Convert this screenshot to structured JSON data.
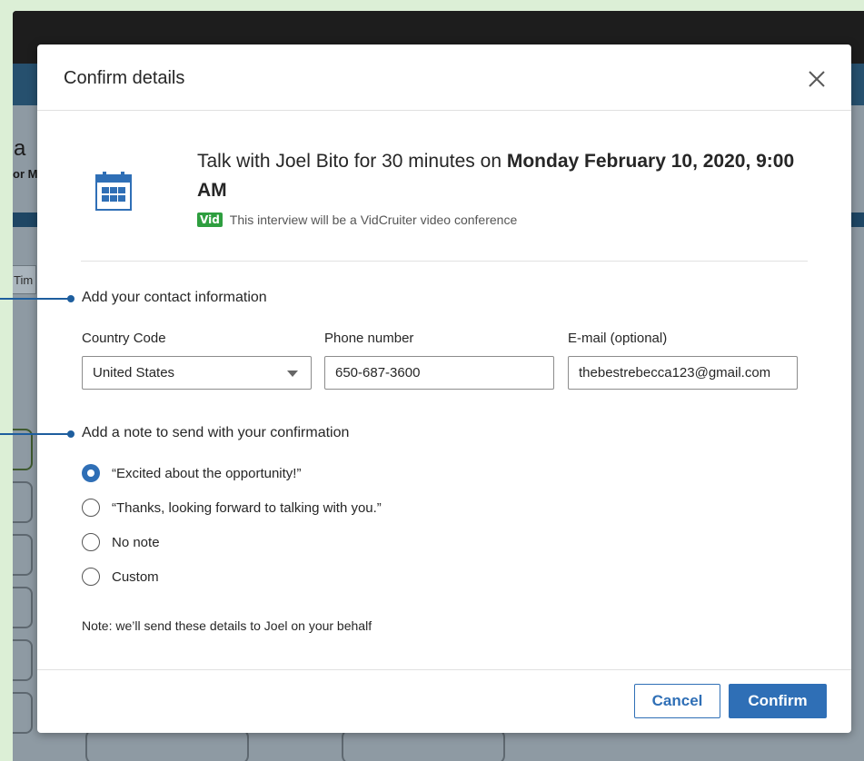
{
  "background": {
    "peek_a": "a",
    "peek_or": "or M",
    "peek_tim": "Tim"
  },
  "modal": {
    "title": "Confirm details",
    "summary": {
      "prefix": "Talk with Joel Bito for 30 minutes on ",
      "datetime": "Monday February 10, 2020, 9:00 AM",
      "vid_badge": "Vid",
      "vid_text": "This interview will be a VidCruiter video conference"
    },
    "contact": {
      "title": "Add your contact information",
      "country_label": "Country Code",
      "country_value": "United States",
      "phone_label": "Phone number",
      "phone_value": "650-687-3600",
      "email_label": "E-mail (optional)",
      "email_value": "thebestrebecca123@gmail.com"
    },
    "note_section": {
      "title": "Add a note to send with your confirmation",
      "options": [
        "“Excited about the opportunity!”",
        "“Thanks, looking forward to talking with you.”",
        "No note",
        "Custom"
      ],
      "selected_index": 0
    },
    "footer_note": "Note: we’ll send these details to Joel on your behalf",
    "buttons": {
      "cancel": "Cancel",
      "confirm": "Confirm"
    }
  },
  "colors": {
    "accent": "#2f6fb6",
    "vid_badge": "#2e9e3f",
    "callout": "#1e5e9e",
    "page_bg": "#dcefd6"
  }
}
